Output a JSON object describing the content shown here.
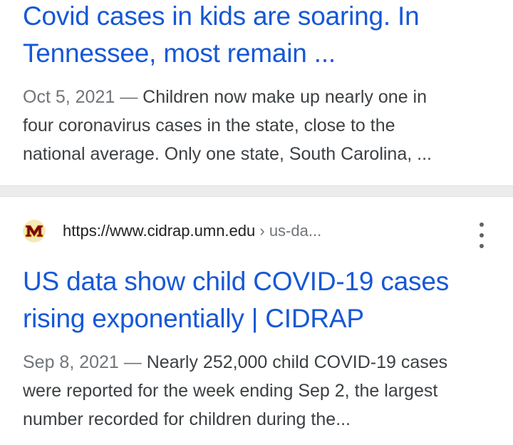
{
  "results": [
    {
      "title_line1": "Covid cases in kids are soaring. In",
      "title_line2": "Tennessee, most remain ...",
      "date": "Oct 5, 2021",
      "separator": "—",
      "snippet_line1": "Children now make up nearly one in",
      "snippet_line2": "four coronavirus cases in the state, close to the",
      "snippet_line3": "national average. Only one state, South Carolina, ..."
    },
    {
      "favicon": "umn-maroon-m-logo",
      "url_domain": "https://www.cidrap.umn.edu",
      "url_path": "› us-da...",
      "more_icon": "more-vert-icon",
      "title_line1": "US data show child COVID-19 cases",
      "title_line2": "rising exponentially | CIDRAP",
      "date": "Sep 8, 2021",
      "separator": "—",
      "snippet_line1": "Nearly 252,000 child COVID-19 cases",
      "snippet_line2": "were reported for the week ending Sep 2, the largest",
      "snippet_line3": "number recorded for children during the..."
    }
  ],
  "colors": {
    "title_link": "#1558d6",
    "snippet_text": "#3c4043",
    "date_text": "#70757a",
    "divider": "#ececec",
    "favicon_bg": "#f6e9ba",
    "favicon_mark": "#7a0019"
  }
}
